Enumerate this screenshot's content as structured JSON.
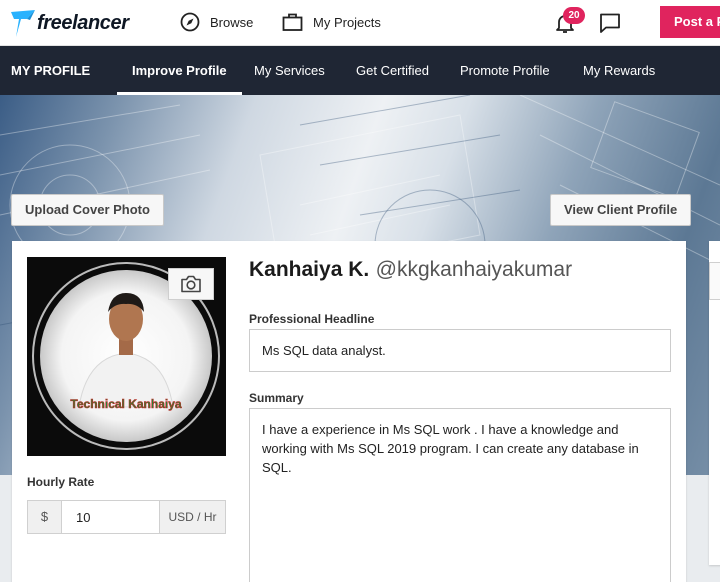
{
  "header": {
    "logo_text": "freelancer",
    "browse_label": "Browse",
    "projects_label": "My Projects",
    "notification_count": "20",
    "post_button_label": "Post a Project"
  },
  "subnav": {
    "title": "MY PROFILE",
    "tabs": [
      {
        "label": "Improve Profile",
        "active": true
      },
      {
        "label": "My Services",
        "active": false
      },
      {
        "label": "Get Certified",
        "active": false
      },
      {
        "label": "Promote Profile",
        "active": false
      },
      {
        "label": "My Rewards",
        "active": false
      }
    ]
  },
  "cover": {
    "upload_label": "Upload Cover Photo",
    "view_client_label": "View Client Profile"
  },
  "profile": {
    "photo_caption": "Technical Kanhaiya",
    "name": "Kanhaiya K.",
    "username": "@kkgkanhaiyakumar",
    "hourly_rate_label": "Hourly Rate",
    "currency_symbol": "$",
    "hourly_rate_value": "10",
    "rate_unit": "USD / Hr",
    "headline_label": "Professional Headline",
    "headline_value": "Ms SQL data analyst.",
    "summary_label": "Summary",
    "summary_value": "I have a experience in Ms SQL work . I have a knowledge and working with Ms SQL 2019 program. I can create any database in SQL."
  },
  "colors": {
    "accent": "#e0245e",
    "nav_bg": "#1f2634",
    "logo_blue": "#29b2fe"
  }
}
